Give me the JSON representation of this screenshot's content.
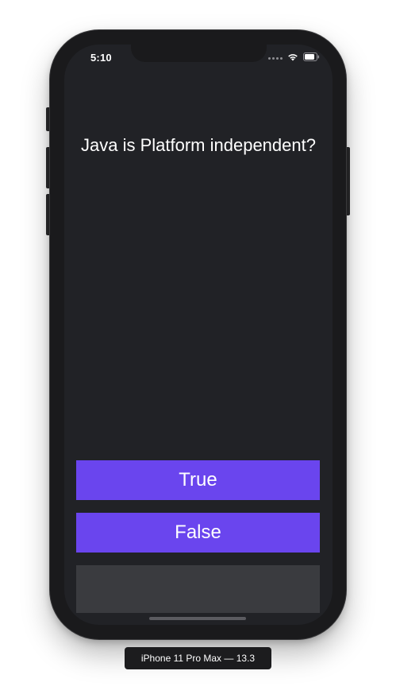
{
  "status_bar": {
    "time": "5:10"
  },
  "quiz": {
    "question": "Java is Platform independent?",
    "true_label": "True",
    "false_label": "False",
    "progress": 0.0
  },
  "simulator": {
    "device_label": "iPhone 11 Pro Max — 13.3"
  },
  "icons": [
    "signal-icon",
    "wifi-icon",
    "battery-icon"
  ],
  "colors": {
    "background": "#212226",
    "accent": "#6a45ee",
    "progress_track": "#3a3b3f",
    "text": "#ffffff"
  }
}
